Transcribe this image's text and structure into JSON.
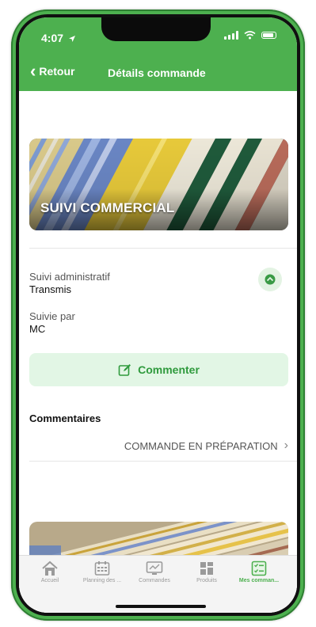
{
  "status_bar": {
    "time": "4:07",
    "location_icon": "location-arrow-icon",
    "signal_icon": "signal-icon",
    "wifi_icon": "wifi-icon",
    "battery_icon": "battery-icon"
  },
  "nav": {
    "back_label": "Retour",
    "title": "Détails commande",
    "color": "#4db04f"
  },
  "hero": {
    "title": "SUIVI COMMERCIAL"
  },
  "details": {
    "admin_label": "Suivi administratif",
    "admin_value": "Transmis",
    "followed_label": "Suivie par",
    "followed_value": "MC",
    "status_icon": "status-indicator-icon"
  },
  "actions": {
    "comment_label": "Commenter",
    "comment_icon": "edit-icon",
    "accent": "#2f9a3d",
    "background": "#e2f6e5"
  },
  "comments": {
    "section_title": "Commentaires",
    "items": [
      {
        "label": "COMMANDE EN PRÉPARATION"
      }
    ]
  },
  "tabbar": {
    "items": [
      {
        "label": "Accueil",
        "icon": "home-icon",
        "active": false
      },
      {
        "label": "Planning des ...",
        "icon": "calendar-icon",
        "active": false
      },
      {
        "label": "Commandes",
        "icon": "monitor-icon",
        "active": false
      },
      {
        "label": "Produits",
        "icon": "grid-icon",
        "active": false
      },
      {
        "label": "Mes comman...",
        "icon": "checklist-icon",
        "active": true
      }
    ]
  }
}
